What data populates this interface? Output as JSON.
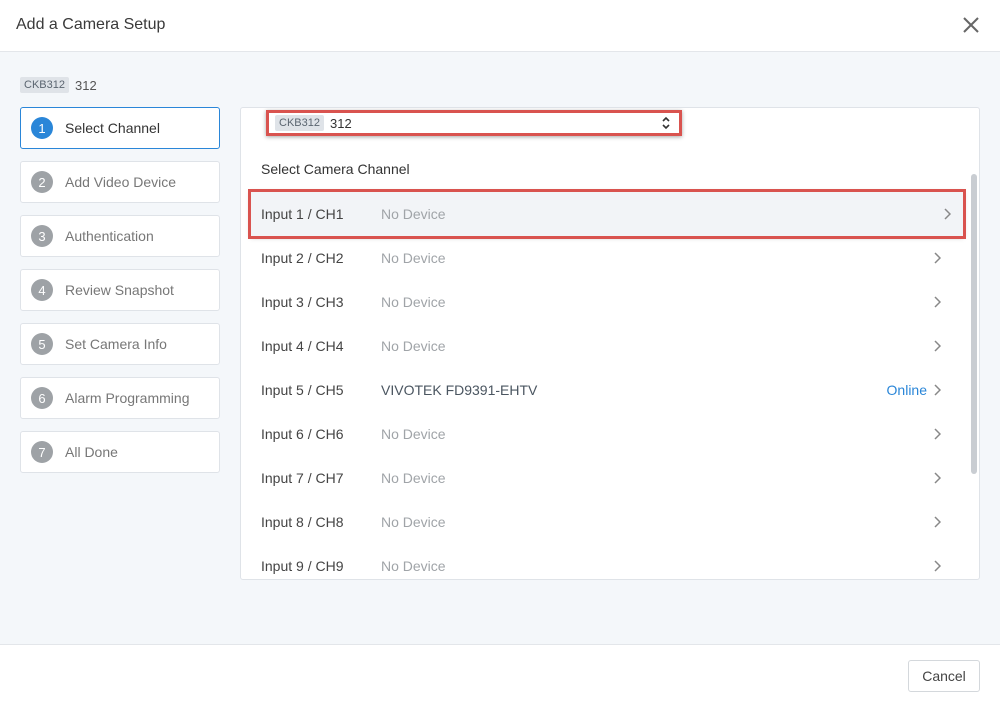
{
  "dialog": {
    "title": "Add a Camera Setup",
    "close_icon": "close-icon"
  },
  "panel": {
    "tag": "CKB312",
    "name": "312"
  },
  "steps": [
    {
      "num": "1",
      "label": "Select Channel",
      "active": true
    },
    {
      "num": "2",
      "label": "Add Video Device",
      "active": false
    },
    {
      "num": "3",
      "label": "Authentication",
      "active": false
    },
    {
      "num": "4",
      "label": "Review Snapshot",
      "active": false
    },
    {
      "num": "5",
      "label": "Set Camera Info",
      "active": false
    },
    {
      "num": "6",
      "label": "Alarm Programming",
      "active": false
    },
    {
      "num": "7",
      "label": "All Done",
      "active": false
    }
  ],
  "panel_select": {
    "tag": "CKB312",
    "value": "312"
  },
  "channel_section": {
    "label": "Select Camera Channel"
  },
  "channels": [
    {
      "input": "Input 1 / CH1",
      "device": "No Device",
      "status": ""
    },
    {
      "input": "Input 2 / CH2",
      "device": "No Device",
      "status": ""
    },
    {
      "input": "Input 3 / CH3",
      "device": "No Device",
      "status": ""
    },
    {
      "input": "Input 4 / CH4",
      "device": "No Device",
      "status": ""
    },
    {
      "input": "Input 5 / CH5",
      "device": "VIVOTEK FD9391-EHTV",
      "status": "Online"
    },
    {
      "input": "Input 6 / CH6",
      "device": "No Device",
      "status": ""
    },
    {
      "input": "Input 7 / CH7",
      "device": "No Device",
      "status": ""
    },
    {
      "input": "Input 8 / CH8",
      "device": "No Device",
      "status": ""
    },
    {
      "input": "Input 9 / CH9",
      "device": "No Device",
      "status": ""
    }
  ],
  "footer": {
    "cancel_label": "Cancel"
  },
  "colors": {
    "accent": "#2a86d8",
    "highlight_border": "#d9534f",
    "step_inactive": "#9ea2a6"
  }
}
